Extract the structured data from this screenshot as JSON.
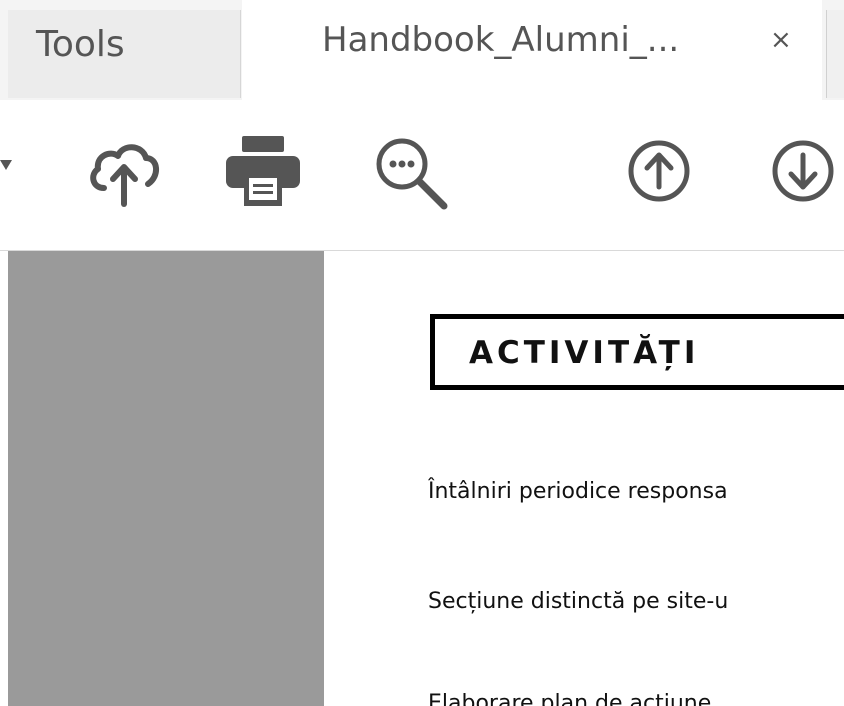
{
  "tabs": {
    "tools_label": "Tools",
    "document_title": "Handbook_Alumni_...",
    "close_symbol": "×"
  },
  "toolbar": {
    "icons": [
      "dropdown-arrow-icon",
      "cloud-upload-icon",
      "print-icon",
      "zoom-search-icon",
      "page-up-icon",
      "page-down-icon"
    ]
  },
  "document": {
    "heading": "ACTIVITĂȚI",
    "paragraphs": [
      "Întâlniri periodice responsa",
      "Secțiune distinctă pe site-u",
      "Elaborare plan de actiune"
    ]
  },
  "colors": {
    "tab_background": "#ececec",
    "active_tab": "#ffffff",
    "side_pane": "#9a9a9a",
    "icon_color": "#555555"
  }
}
